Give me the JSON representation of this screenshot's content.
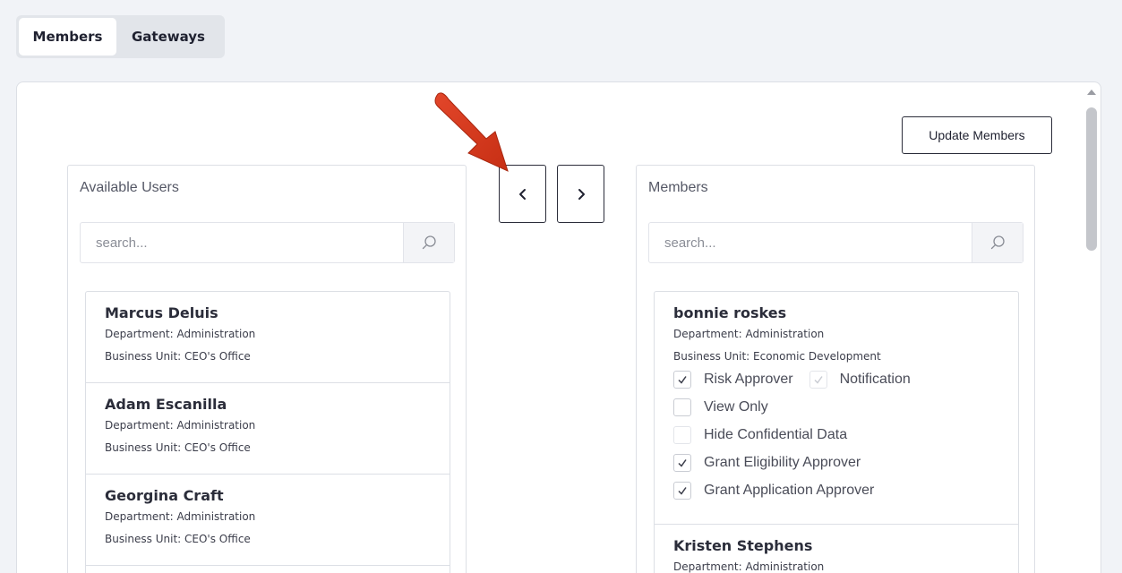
{
  "tabs": [
    {
      "label": "Members",
      "active": true
    },
    {
      "label": "Gateways",
      "active": false
    }
  ],
  "toolbar": {
    "update_label": "Update Members"
  },
  "available": {
    "title": "Available Users",
    "search_placeholder": "search...",
    "users": [
      {
        "name": "Marcus Deluis",
        "department": "Department: Administration",
        "unit": "Business Unit: CEO's Office"
      },
      {
        "name": "Adam Escanilla",
        "department": "Department: Administration",
        "unit": "Business Unit: CEO's Office"
      },
      {
        "name": "Georgina Craft",
        "department": "Department: Administration",
        "unit": "Business Unit: CEO's Office"
      }
    ]
  },
  "members": {
    "title": "Members",
    "search_placeholder": "search...",
    "users": [
      {
        "name": "bonnie roskes",
        "department": "Department: Administration",
        "unit": "Business Unit: Economic Development",
        "permissions": {
          "risk_approver": {
            "label": "Risk Approver",
            "checked": true
          },
          "notification": {
            "label": "Notification",
            "checked": true,
            "disabled": true
          },
          "view_only": {
            "label": "View Only",
            "checked": false
          },
          "hide_confidential": {
            "label": "Hide Confidential Data",
            "checked": false,
            "disabled": true
          },
          "grant_eligibility": {
            "label": "Grant Eligibility Approver",
            "checked": true
          },
          "grant_application": {
            "label": "Grant Application Approver",
            "checked": true
          }
        }
      },
      {
        "name": "Kristen Stephens",
        "department": "Department: Administration"
      }
    ]
  },
  "icons": {
    "search": "search-icon",
    "prev": "chevron-left-icon",
    "next": "chevron-right-icon",
    "check": "check-icon"
  },
  "colors": {
    "annotation_arrow": "#d93a1c",
    "background": "#f1f3f7"
  }
}
